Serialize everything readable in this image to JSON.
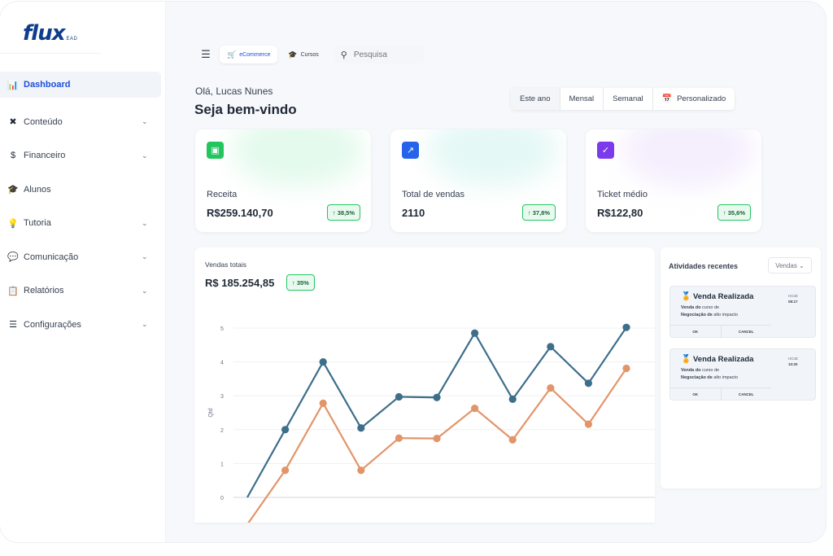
{
  "brand": {
    "logo": "flux",
    "logo_sub": "EAD"
  },
  "sidebar": {
    "items": [
      {
        "label": "Dashboard",
        "icon": "bar-chart-icon",
        "glyph": "📊",
        "active": true,
        "chevron": false
      },
      {
        "label": "Conteúdo",
        "icon": "tools-icon",
        "glyph": "✖",
        "chevron": true
      },
      {
        "label": "Financeiro",
        "icon": "dollar-icon",
        "glyph": "$",
        "chevron": true
      },
      {
        "label": "Alunos",
        "icon": "graduation-cap-icon",
        "glyph": "🎓",
        "chevron": false
      },
      {
        "label": "Tutoria",
        "icon": "lightbulb-icon",
        "glyph": "💡",
        "chevron": true
      },
      {
        "label": "Comunicação",
        "icon": "chat-icon",
        "glyph": "💬",
        "chevron": true
      },
      {
        "label": "Relatórios",
        "icon": "clipboard-icon",
        "glyph": "📋",
        "chevron": true
      },
      {
        "label": "Configurações",
        "icon": "sliders-icon",
        "glyph": "☰",
        "chevron": true
      }
    ]
  },
  "topbar": {
    "menu_icon": "hamburger-icon",
    "tabs": [
      {
        "label": "eCommerce",
        "icon": "cart-icon",
        "active": true
      },
      {
        "label": "Cursos",
        "icon": "graduation-cap-icon",
        "active": false
      }
    ],
    "search_placeholder": "Pesquisa"
  },
  "header": {
    "greeting": "Olá, Lucas Nunes",
    "title": "Seja bem-vindo"
  },
  "period": {
    "options": [
      "Este ano",
      "Mensal",
      "Semanal",
      "Personalizado"
    ],
    "selected": "Este ano"
  },
  "cards": [
    {
      "label": "Receita",
      "value": "R$259.140,70",
      "change": "↑ 38,5%",
      "icon": "wallet-icon",
      "color": "#22c55e",
      "glow": "#c7f5d9"
    },
    {
      "label": "Total de vendas",
      "value": "2110",
      "change": "↑ 37,8%",
      "icon": "trend-chart-icon",
      "color": "#2563eb",
      "glow": "#c9f2ea"
    },
    {
      "label": "Ticket médio",
      "value": "R$122,80",
      "change": "↑ 35,6%",
      "icon": "check-calendar-icon",
      "color": "#7c3aed",
      "glow": "#e9ddfb"
    }
  ],
  "sales": {
    "title": "Vendas totais",
    "value": "R$ 185.254,85",
    "change": "↑ 35%"
  },
  "chart_data": {
    "type": "line",
    "ylabel": "Qtd",
    "xlabel": "",
    "ylim": [
      0,
      5
    ],
    "yticks": [
      "0",
      "1",
      "2",
      "3",
      "4",
      "5"
    ],
    "grid": true,
    "x": [
      0,
      1,
      2,
      3,
      4,
      5,
      6,
      7,
      8,
      9,
      10
    ],
    "series": [
      {
        "color": "#3d6e8a",
        "values": [
          0.0,
          2.0,
          4.0,
          2.05,
          2.97,
          2.95,
          4.85,
          2.9,
          4.45,
          3.37,
          5.02
        ]
      },
      {
        "color": "#e2956a",
        "values": [
          -0.8,
          0.8,
          2.78,
          0.8,
          1.75,
          1.74,
          2.63,
          1.7,
          3.23,
          2.16,
          3.81
        ]
      }
    ]
  },
  "activity": {
    "title": "Atividades recentes",
    "filter": "Vendas ⌄",
    "items": [
      {
        "icon": "medal-icon",
        "title": "Venda Realizada",
        "desc_a": "Venda do",
        "desc_b": " curso de",
        "desc_c": "Negociação de",
        "desc_d": " alto impacto",
        "day": "HOJE",
        "time": "08:17",
        "ok": "OK",
        "cancel": "CANCEL"
      },
      {
        "icon": "medal-icon",
        "title": "Venda Realizada",
        "desc_a": "Venda do",
        "desc_b": " curso de",
        "desc_c": "Negociação de",
        "desc_d": " alto impacto",
        "day": "HOJE",
        "time": "10:20",
        "ok": "OK",
        "cancel": "CANCEL"
      }
    ]
  }
}
